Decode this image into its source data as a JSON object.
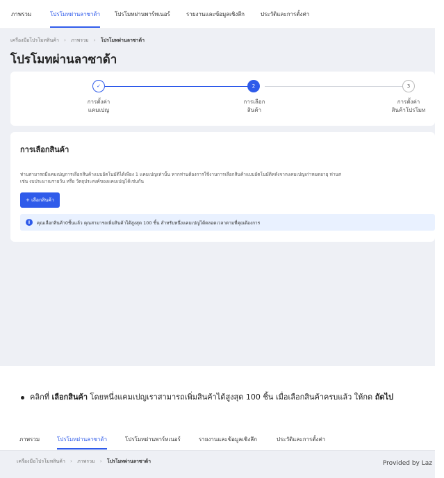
{
  "top_nav": {
    "tabs": [
      {
        "label": "ภาพรวม"
      },
      {
        "label": "โปรโมทผ่านลาซาด้า"
      },
      {
        "label": "โปรโมทผ่านพาร์ทเนอร์"
      },
      {
        "label": "รายงานและข้อมูลเชิงลึก"
      },
      {
        "label": "ประวัติและการตั้งค่า"
      }
    ]
  },
  "breadcrumb": {
    "items": [
      "เครื่องมือโปรโมทสินค้า",
      "ภาพรวม",
      "โปรโมทผ่านลาซาด้า"
    ],
    "separator": "›"
  },
  "page_title": "โปรโมทผ่านลาซาด้า",
  "stepper": {
    "steps": [
      {
        "marker": "✓",
        "line1": "การตั้งค่า",
        "line2": "แคมเปญ"
      },
      {
        "marker": "2",
        "line1": "การเลือก",
        "line2": "สินค้า"
      },
      {
        "marker": "3",
        "line1": "การตั้งค่า",
        "line2": "สินค้าโปรโมท"
      }
    ]
  },
  "product_selection": {
    "title": "การเลือกสินค้า",
    "description_line1": "ท่านสามารถมีแคมเปญการเลือกสินค้าแบบอัตโนมัติได้เพียง 1 แคมเปญเท่านั้น หากท่านต้องการใช้งานการเลือกสินค้าแบบอัตโนมัติหลังจากแคมเปญเก่าหมดอายุ ท่านส",
    "description_line2": "เช่น งบประมาณรายวัน หรือ วัตถุประสงค์ของแคมเปญได้เช่นกัน",
    "add_button_label": "+ เลือกสินค้า",
    "info_icon": "i",
    "info_text": "คุณเลือกสินค้า0ชิ้นแล้ว คุณสามารถเพิ่มสินค้าได้สูงสุด 100 ชิ้น สำหรับหนึ่งแคมเปญได้ตลอดเวลาตามที่คุณต้องการ"
  },
  "instruction": {
    "prefix": "คลิกที่ ",
    "bold1": "เลือกสินค้า",
    "middle": " โดยหนึ่งแคมเปญเราสามารถเพิ่มสินค้าได้สูงสุด 100 ชิ้น เมื่อเลือกสินค้าครบแล้ว ให้กด ",
    "bold2": "ถัดไป"
  },
  "second_screenshot": {
    "tabs": [
      {
        "label": "ภาพรวม"
      },
      {
        "label": "โปรโมทผ่านลาซาด้า"
      },
      {
        "label": "โปรโมทผ่านพาร์ทเนอร์"
      },
      {
        "label": "รายงานและข้อมูลเชิงลึก"
      },
      {
        "label": "ประวัติและการตั้งค่า"
      }
    ],
    "breadcrumb": [
      "เครื่องมือโปรโมทสินค้า",
      "ภาพรวม",
      "โปรโมทผ่านลาซาด้า"
    ],
    "provided_by": "Provided by Laz"
  },
  "colors": {
    "accent": "#2f5bea",
    "background": "#eef0f5",
    "info_bg": "#e9f1ff"
  }
}
